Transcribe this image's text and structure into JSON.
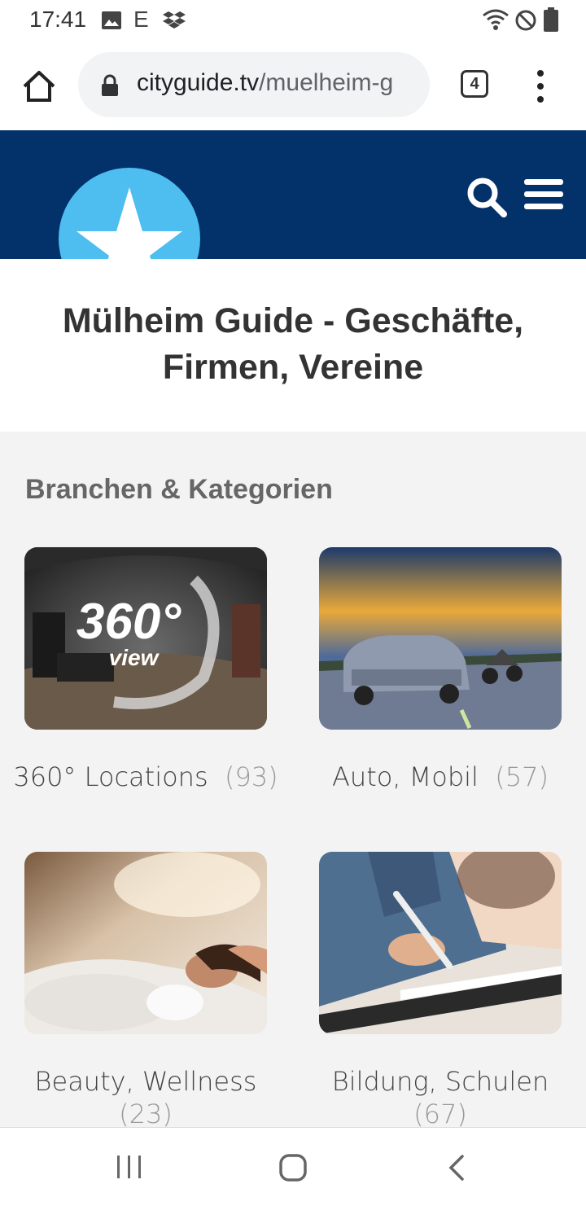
{
  "status_bar": {
    "time": "17:41",
    "e_indicator": "E",
    "icons": [
      "image-icon",
      "e-icon",
      "dropbox-icon",
      "wifi-icon",
      "dnd-icon",
      "battery-icon"
    ]
  },
  "browser": {
    "url_host": "cityguide.tv",
    "url_path": "/muelheim-g",
    "tab_count": "4",
    "icons": [
      "home-icon",
      "lock-icon",
      "more-vert-icon"
    ]
  },
  "site_header": {
    "background": "#03326b",
    "logo_color": "#4ebdf0",
    "icons": [
      "star-logo",
      "search-icon",
      "hamburger-icon"
    ]
  },
  "page": {
    "title": "Mülheim Guide - Geschäfte, Firmen, Vereine",
    "section_heading": "Branchen & Kategorien"
  },
  "categories": [
    {
      "label": "360° Locations",
      "count": "(93)",
      "image_overlay": "360°",
      "image_overlay_sub": "view"
    },
    {
      "label": "Auto, Mobil",
      "count": "(57)"
    },
    {
      "label": "Beauty, Wellness",
      "count": "(23)"
    },
    {
      "label": "Bildung, Schulen",
      "count": "(67)"
    }
  ],
  "nav_bar": {
    "icons": [
      "recent-apps-icon",
      "home-circle-icon",
      "back-icon"
    ]
  }
}
